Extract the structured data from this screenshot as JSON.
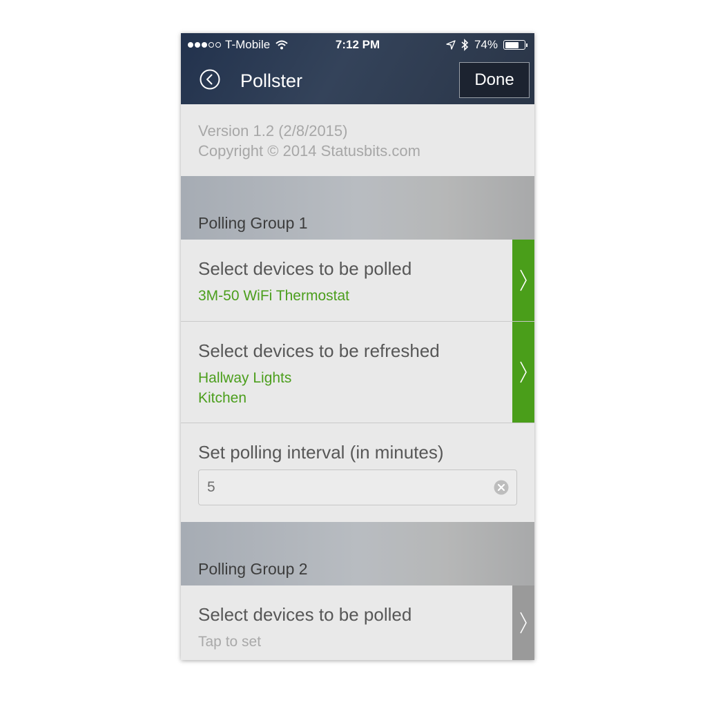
{
  "status_bar": {
    "carrier": "T-Mobile",
    "time": "7:12 PM",
    "battery": "74%",
    "battery_level": 0.74
  },
  "nav": {
    "title": "Pollster",
    "done_label": "Done"
  },
  "about": {
    "version": "Version 1.2 (2/8/2015)",
    "copyright": "Copyright © 2014 Statusbits.com"
  },
  "groups": [
    {
      "header": "Polling Group 1",
      "polled": {
        "title": "Select devices to be polled",
        "values": [
          "3M-50 WiFi Thermostat"
        ]
      },
      "refreshed": {
        "title": "Select devices to be refreshed",
        "values": [
          "Hallway Lights",
          "Kitchen"
        ]
      },
      "interval": {
        "label": "Set polling interval (in minutes)",
        "value": "5"
      }
    },
    {
      "header": "Polling Group 2",
      "polled": {
        "title": "Select devices to be polled",
        "placeholder": "Tap to set"
      }
    }
  ],
  "colors": {
    "accent_green": "#4a9e1a",
    "inactive_gray": "#9a9a9a",
    "header_navy": "#27344b"
  }
}
